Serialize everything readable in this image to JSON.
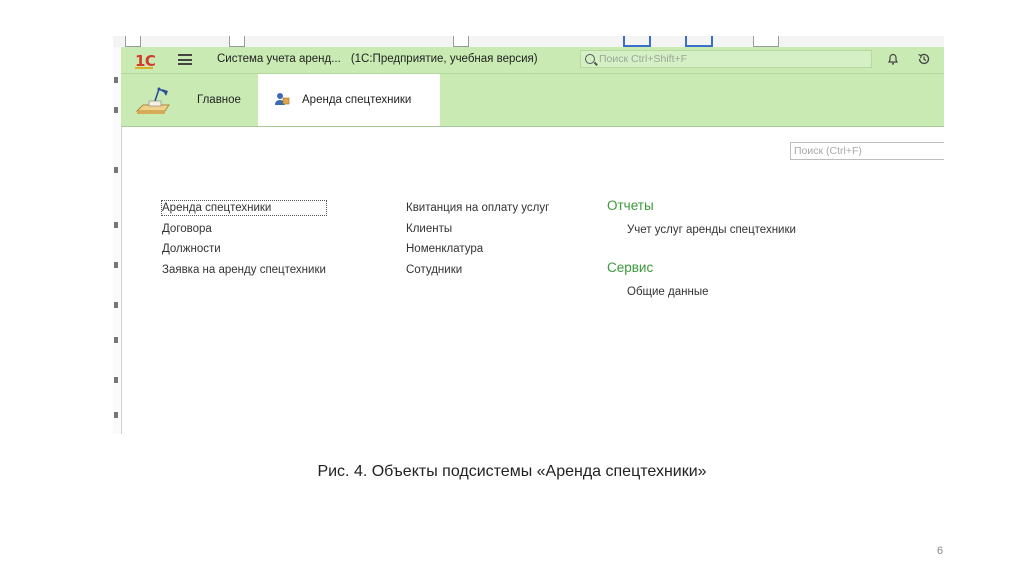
{
  "window": {
    "app_title": "Система учета аренд...",
    "platform_title": "(1С:Предприятие, учебная версия)",
    "search_placeholder": "Поиск Ctrl+Shift+F"
  },
  "logo": {
    "text": "1C"
  },
  "sections": [
    {
      "label": "Главное",
      "icon": "desk-lamp-icon"
    },
    {
      "label": "Аренда спецтехники",
      "icon": "person-icon",
      "active": true
    }
  ],
  "content": {
    "search_placeholder": "Поиск (Ctrl+F)",
    "column1": [
      "Аренда спецтехники",
      "Договора",
      "Должности",
      "Заявка на аренду спецтехники"
    ],
    "column2": [
      "Квитанция на оплату услуг",
      "Клиенты",
      "Номенклатура",
      "Сотудники"
    ],
    "reports_title": "Отчеты",
    "reports": [
      "Учет услуг аренды спецтехники"
    ],
    "service_title": "Сервис",
    "service": [
      "Общие данные"
    ]
  },
  "caption": "Рис. 4. Объекты подсистемы «Аренда спецтехники»",
  "page_number": "6",
  "colors": {
    "title_bar": "#c9ebb3",
    "group_title": "#3a9a3a",
    "logo": "#d43b2a"
  }
}
